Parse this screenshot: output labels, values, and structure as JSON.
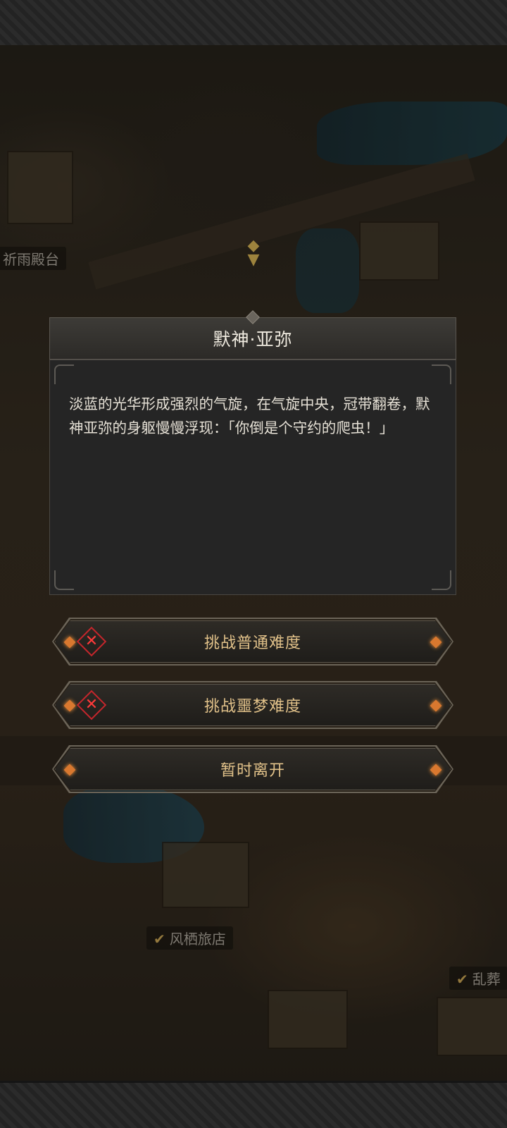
{
  "map": {
    "locations": [
      {
        "name": "祈雨殿台",
        "checked": false
      },
      {
        "name": "风栖旅店",
        "checked": true
      },
      {
        "name": "乱葬",
        "checked": true
      }
    ]
  },
  "dialog": {
    "title": "默神·亚弥",
    "text": "淡蓝的光华形成强烈的气旋，在气旋中央，冠带翻卷，默神亚弥的身躯慢慢浮现：「你倒是个守约的爬虫！」"
  },
  "choices": [
    {
      "label": "挑战普通难度",
      "locked_icon": "red-x-icon"
    },
    {
      "label": "挑战噩梦难度",
      "locked_icon": "red-x-icon"
    },
    {
      "label": "暂时离开"
    }
  ],
  "colors": {
    "choice_text": "#e2c28a",
    "gem": "#d9782f",
    "lock_red": "#c4262c",
    "dialog_bg": "#252525"
  }
}
